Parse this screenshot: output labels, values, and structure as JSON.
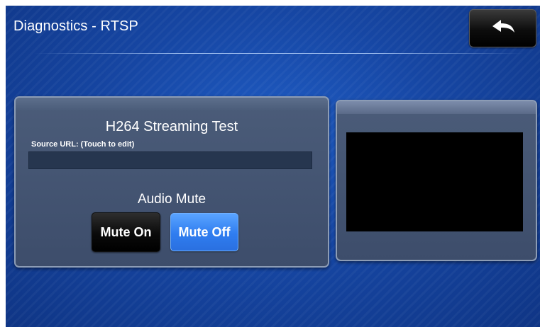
{
  "header": {
    "title": "Diagnostics - RTSP",
    "back_icon": "back-arrow-icon"
  },
  "stream_panel": {
    "title": "H264 Streaming Test",
    "source_label": "Source URL: (Touch to edit)",
    "source_url_value": ""
  },
  "audio": {
    "label": "Audio Mute",
    "mute_on_label": "Mute On",
    "mute_off_label": "Mute Off",
    "selected": "Mute Off"
  },
  "colors": {
    "background": "#1646a3",
    "accent_selected": "#2f7df0",
    "button_dark": "#0a0a0a"
  }
}
